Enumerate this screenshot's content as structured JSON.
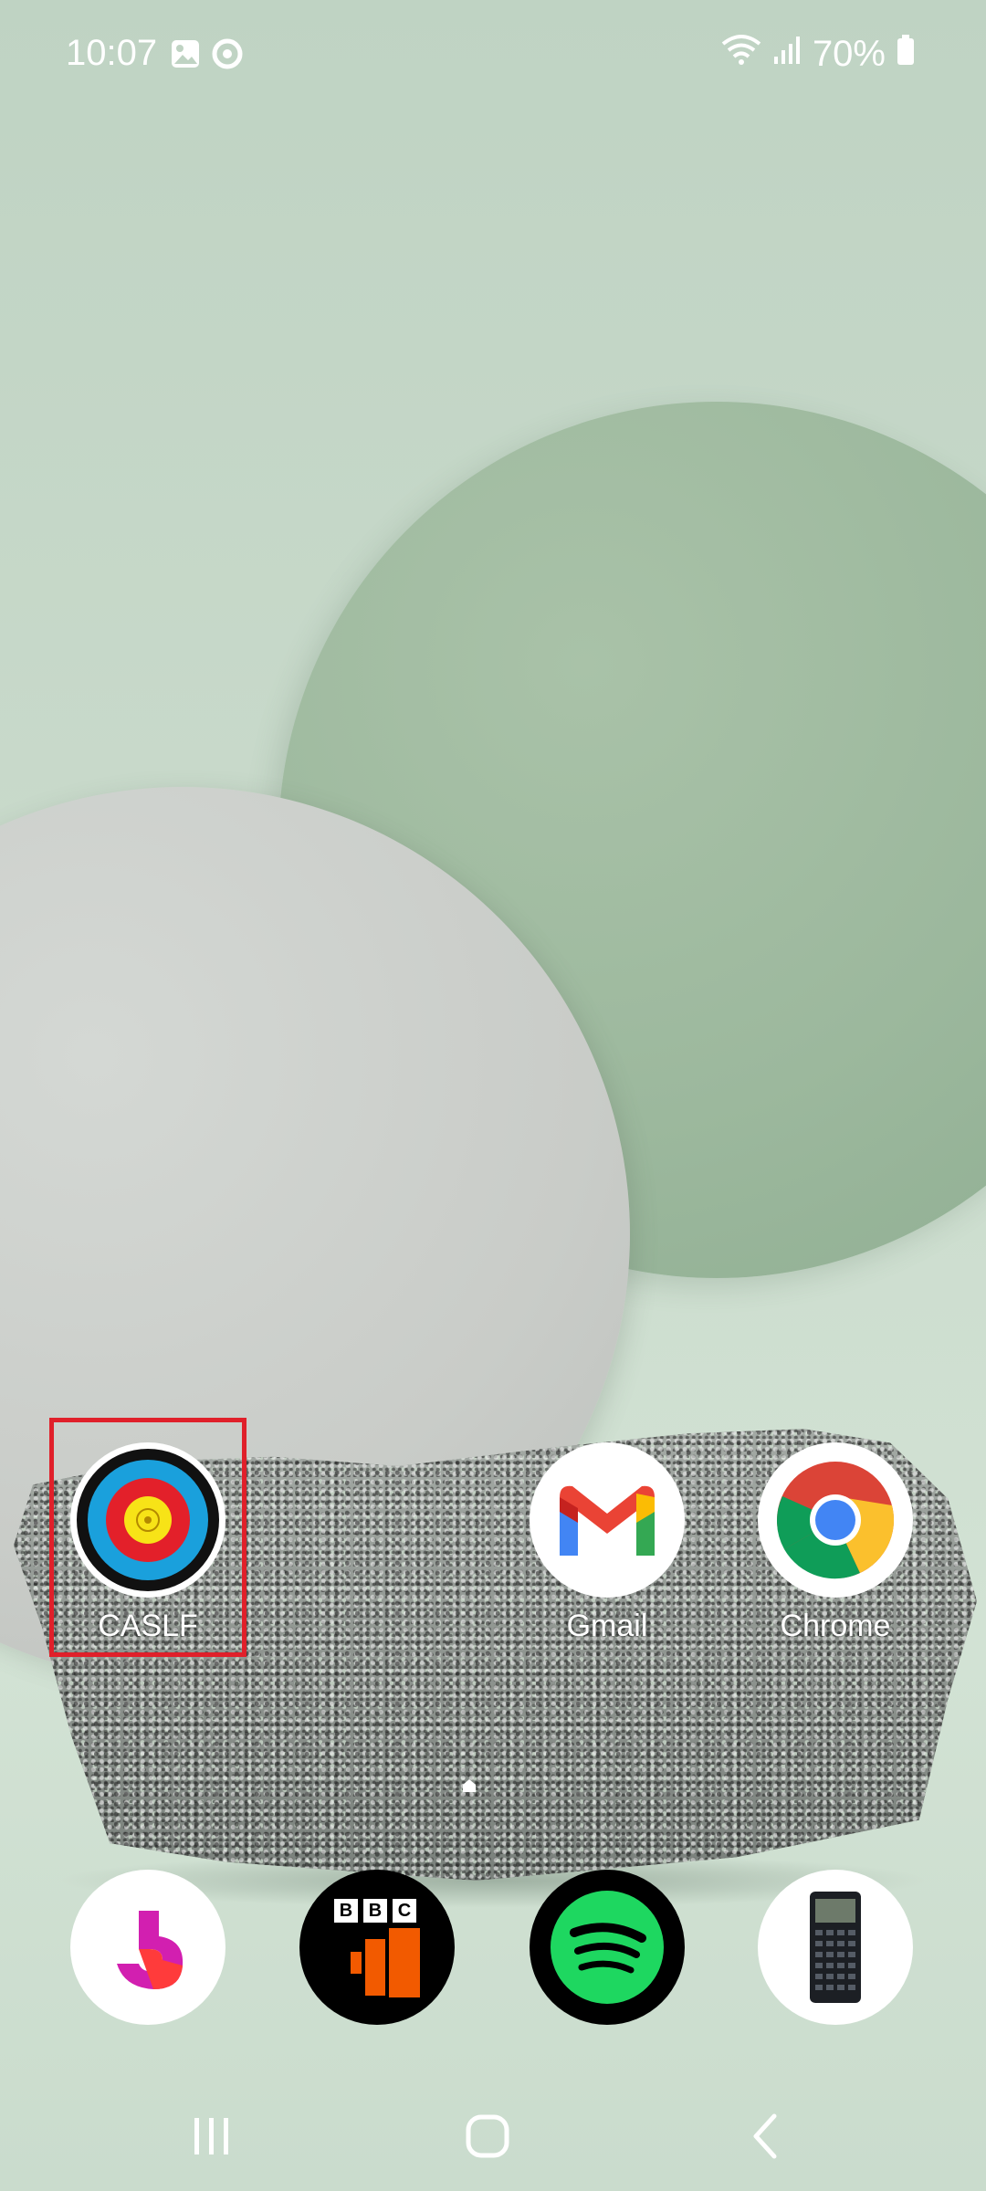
{
  "status_bar": {
    "time": "10:07",
    "battery_percent": "70%",
    "notification_icons": [
      "gallery-icon",
      "chrome-icon"
    ],
    "system_icons": [
      "wifi-icon",
      "signal-icon",
      "battery-icon"
    ]
  },
  "home_apps": [
    {
      "label": "CASLF",
      "icon": "archery-target-icon"
    },
    {
      "label": "Gmail",
      "icon": "gmail-icon"
    },
    {
      "label": "Chrome",
      "icon": "chrome-icon"
    }
  ],
  "dock_apps": [
    {
      "icon": "pink-orange-app-icon"
    },
    {
      "icon": "bbc-sounds-icon",
      "text": "BBC"
    },
    {
      "icon": "spotify-icon"
    },
    {
      "icon": "calculator-icon"
    }
  ],
  "highlight": {
    "target": "CASLF",
    "color": "#e0202a"
  },
  "nav_bar": [
    "recent-apps-icon",
    "home-icon",
    "back-icon"
  ],
  "colors": {
    "gmail_red": "#ea4335",
    "gmail_blue": "#4285f4",
    "gmail_green": "#34a853",
    "gmail_yellow": "#fbbc04",
    "spotify_green": "#1ed760",
    "bbc_orange": "#f25a00"
  }
}
